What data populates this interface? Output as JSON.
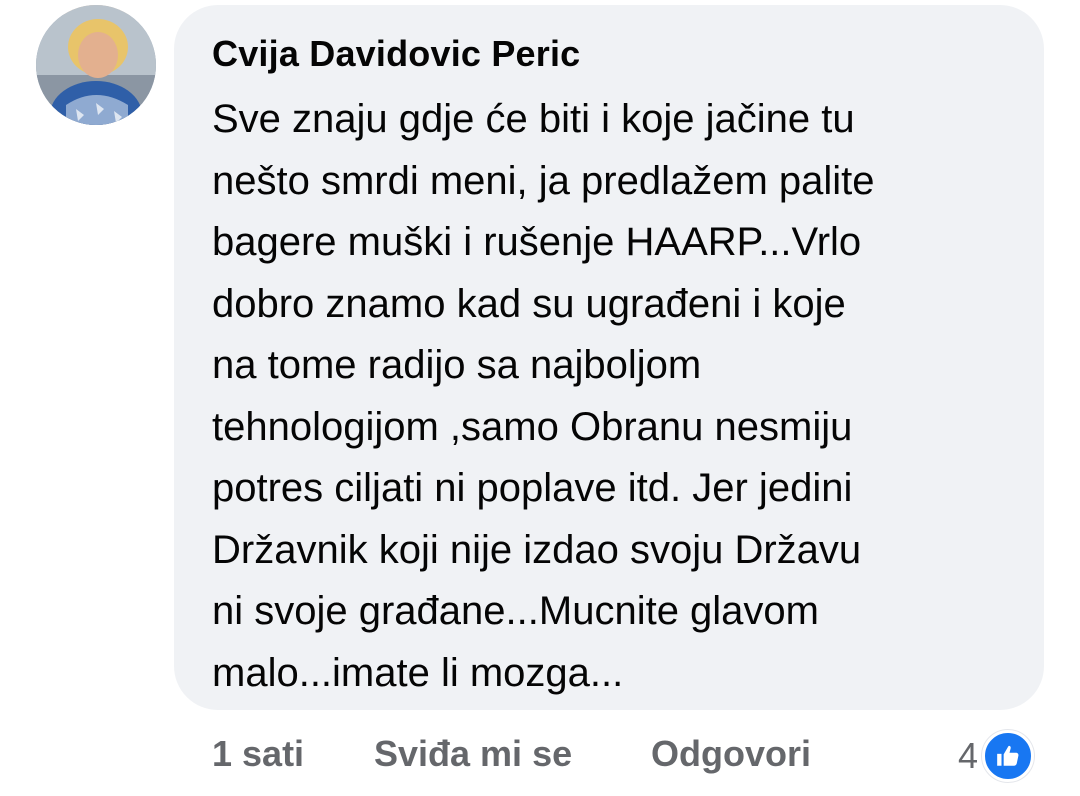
{
  "comment": {
    "author": "Cvija Davidovic Peric",
    "text_lines": [
      "Sve znaju gdje će biti i koje jačine tu",
      "nešto smrdi meni, ja predlažem palite",
      "bagere muški i rušenje HAARP...Vrlo",
      "dobro znamo kad su ugrađeni i koje",
      "na tome radijo sa najboljom",
      "tehnologijom ,samo Obranu nesmiju",
      "potres ciljati ni poplave itd. Jer jedini",
      "Državnik koji nije izdao svoju Državu",
      "ni svoje građane...Mucnite glavom",
      "malo...imate li mozga..."
    ]
  },
  "actions": {
    "time": "1 sati",
    "like_label": "Sviđa mi se",
    "reply_label": "Odgovori"
  },
  "reactions": {
    "count": "4",
    "icon": "like-thumb-icon",
    "color": "#1877f2"
  },
  "colors": {
    "bubble_bg": "#f0f2f5",
    "secondary_text": "#65676b",
    "primary_text": "#050505"
  }
}
